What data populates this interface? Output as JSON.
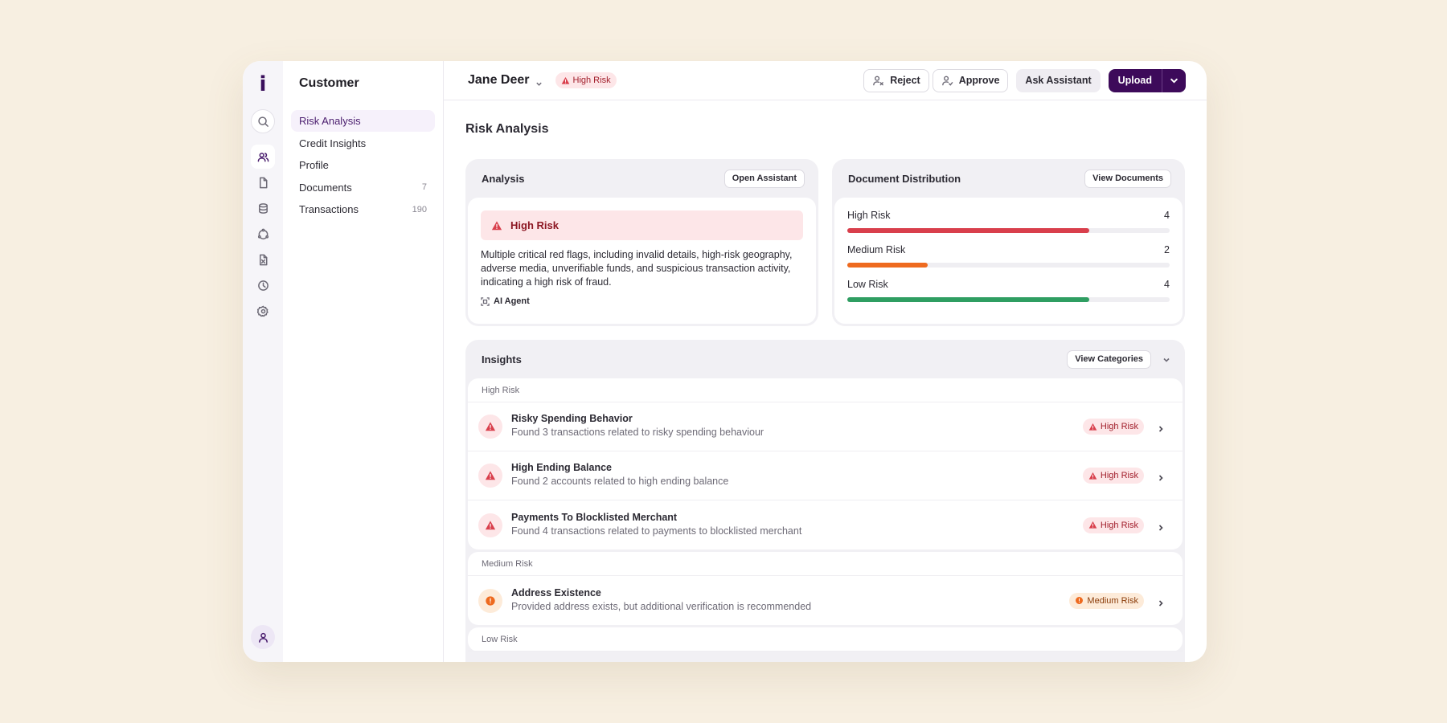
{
  "app": {
    "logo": "i"
  },
  "subnav": {
    "title": "Customer",
    "items": [
      {
        "label": "Risk Analysis",
        "count": ""
      },
      {
        "label": "Credit Insights",
        "count": ""
      },
      {
        "label": "Profile",
        "count": ""
      },
      {
        "label": "Documents",
        "count": "7"
      },
      {
        "label": "Transactions",
        "count": "190"
      }
    ]
  },
  "header": {
    "customer_name": "Jane Deer",
    "risk_badge": "High Risk",
    "reject_label": "Reject",
    "approve_label": "Approve",
    "ask_label": "Ask Assistant",
    "upload_label": "Upload"
  },
  "page": {
    "title": "Risk Analysis"
  },
  "analysis": {
    "title": "Analysis",
    "button": "Open Assistant",
    "alert": "High Risk",
    "text": "Multiple critical red flags, including invalid details, high-risk geography, adverse media, unverifiable funds, and suspicious transaction activity, indicating a high risk of fraud.",
    "agent": "AI Agent"
  },
  "distribution": {
    "title": "Document Distribution",
    "button": "View Documents",
    "rows": [
      {
        "label": "High Risk",
        "value": "4",
        "fraction": 0.75,
        "color": "#d93f4c"
      },
      {
        "label": "Medium Risk",
        "value": "2",
        "fraction": 0.25,
        "color": "#ee6a1f"
      },
      {
        "label": "Low Risk",
        "value": "4",
        "fraction": 0.75,
        "color": "#2f9e62"
      }
    ]
  },
  "insights": {
    "title": "Insights",
    "button": "View Categories",
    "groups": [
      {
        "label": "High Risk",
        "rows": [
          {
            "title": "Risky Spending Behavior",
            "sub": "Found 3 transactions related to risky spending behaviour",
            "badge": "High Risk"
          },
          {
            "title": "High Ending Balance",
            "sub": "Found 2 accounts related to high ending balance",
            "badge": "High Risk"
          },
          {
            "title": "Payments To Blocklisted Merchant",
            "sub": "Found 4 transactions related to payments to blocklisted merchant",
            "badge": "High Risk"
          }
        ]
      },
      {
        "label": "Medium Risk",
        "rows": [
          {
            "title": "Address Existence",
            "sub": "Provided address exists, but additional verification is recommended",
            "badge": "Medium Risk"
          }
        ]
      },
      {
        "label": "Low Risk",
        "rows": []
      }
    ]
  },
  "colors": {
    "brand": "#3d0a5a",
    "high": "#d93f4c",
    "medium": "#ee6a1f",
    "low": "#2f9e62",
    "background": "#f7efe1"
  }
}
